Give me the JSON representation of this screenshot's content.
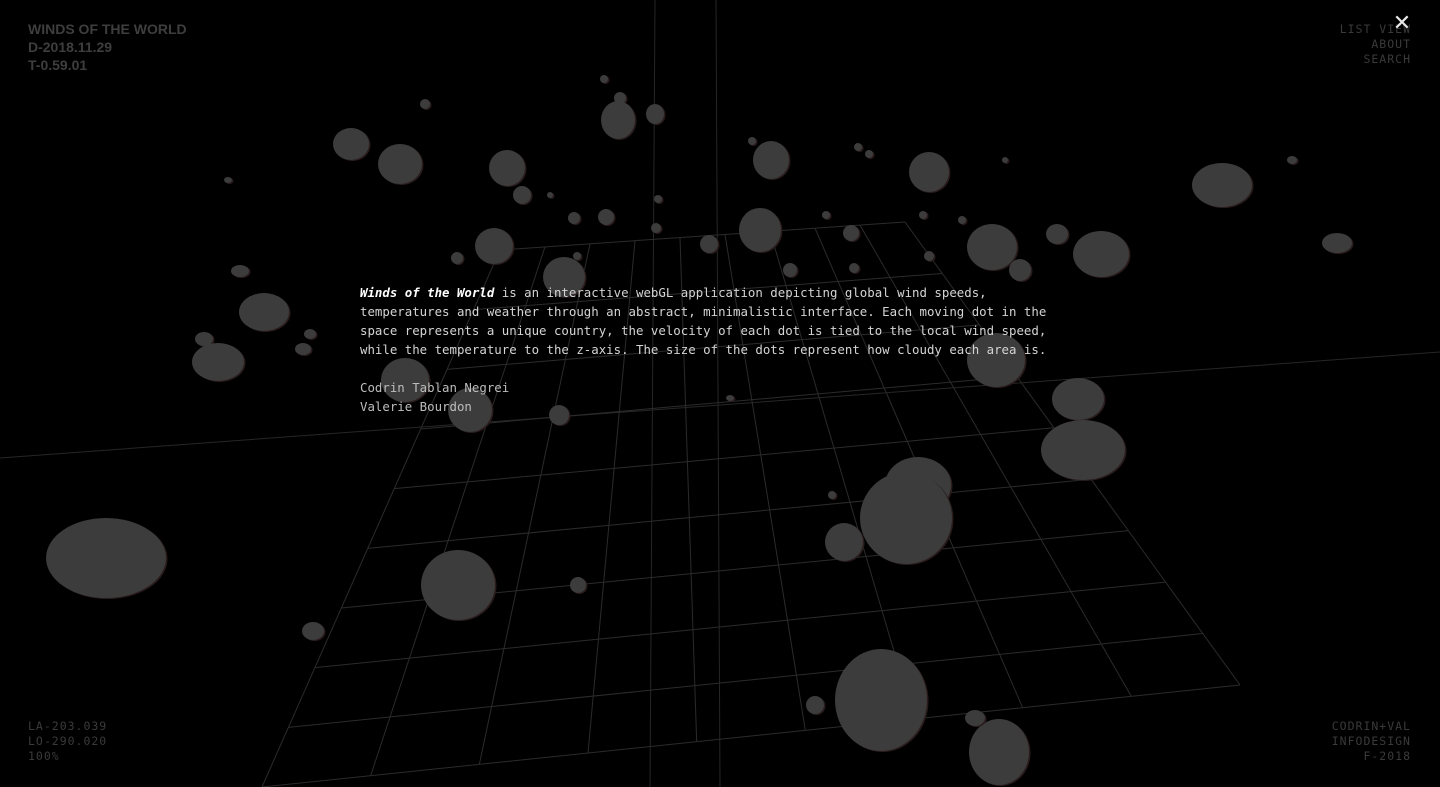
{
  "header": {
    "title": "WINDS OF THE WORLD",
    "date": "D-2018.11.29",
    "time": "T-0.59.01"
  },
  "nav": {
    "list_view": "LIST VIEW",
    "about": "ABOUT",
    "search": "SEARCH"
  },
  "close": {
    "icon": "close-icon",
    "glyph": "✕"
  },
  "about": {
    "lead": "Winds of the World",
    "body": " is an interactive webGL application depicting global wind speeds, temperatures and weather through an abstract, minimalistic interface. Each moving dot in the space represents a unique country, the velocity of each dot is tied to the local wind speed, while the temperature to the z-axis. The size of the dots represent how cloudy each area is.",
    "authors": [
      "Codrin Tablan Negrei",
      "Valerie Bourdon"
    ]
  },
  "coords": {
    "la": "LA-203.039",
    "lo": "LO-290.020",
    "zoom": "100%"
  },
  "credits": {
    "line1": "CODRIN+VAL",
    "line2": "INFODESIGN",
    "line3": "F-2018"
  },
  "colors": {
    "background": "#000000",
    "dot": "#3c3c3c",
    "grid": "#2b2b2b",
    "text": "#d4d4d4"
  }
}
